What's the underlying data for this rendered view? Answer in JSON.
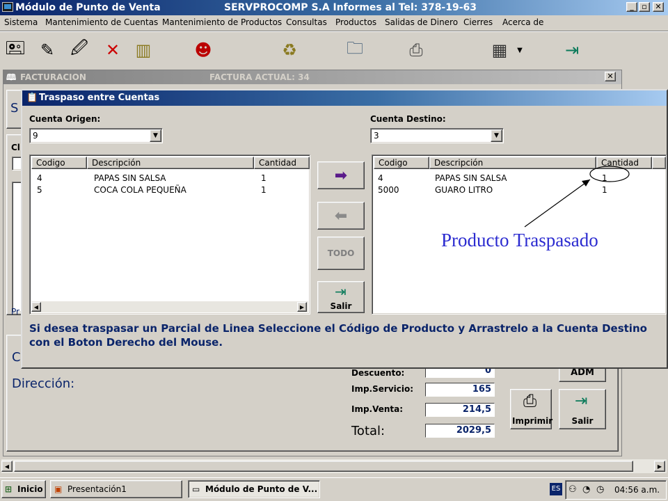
{
  "main_window": {
    "title": "Módulo de Punto de Venta",
    "company": "SERVPROCOMP S.A  Informes al Tel:  378-19-63",
    "controls": [
      "_",
      "▫",
      "✕"
    ]
  },
  "menu": [
    "Sistema",
    "Mantenimiento de Cuentas",
    "Mantenimiento de Productos",
    "Consultas",
    "Productos",
    "Salidas de Dinero",
    "Cierres",
    "Acerca de"
  ],
  "toolbar_icons": [
    "cash-register-icon",
    "edit-document-icon",
    "write-icon",
    "delete-icon",
    "basket-icon",
    "user-icon",
    "recycle-bin-icon",
    "folder-icon",
    "printer-icon",
    "calculator-icon",
    "exit-door-icon"
  ],
  "factura_window": {
    "title": "FACTURACION",
    "current": "FACTURA ACTUAL:  34",
    "left_fragments": [
      "S",
      "Cl",
      "C",
      "Pr"
    ],
    "direccion_label": "Dirección:",
    "c_label": "C",
    "descuento_label": "Descuento:",
    "descuento_value": "0",
    "imp_servicio_label": "Imp.Servicio:",
    "imp_servicio_value": "165",
    "imp_venta_label": "Imp.Venta:",
    "imp_venta_value": "214,5",
    "total_label": "Total:",
    "total_value": "2029,5",
    "adm_label": "ADM",
    "imprimir_label": "Imprimir",
    "salir_label": "Salir"
  },
  "dialog": {
    "title": "Traspaso entre Cuentas",
    "origen_label": "Cuenta Origen:",
    "origen_value": "9",
    "destino_label": "Cuenta Destino:",
    "destino_value": "3",
    "columns": [
      "Codigo",
      "Descripción",
      "Cantidad"
    ],
    "origen_rows": [
      {
        "codigo": "4",
        "descripcion": "PAPAS SIN SALSA",
        "cantidad": "1"
      },
      {
        "codigo": "5",
        "descripcion": "COCA COLA PEQUEÑA",
        "cantidad": "1"
      }
    ],
    "destino_rows": [
      {
        "codigo": "4",
        "descripcion": "PAPAS SIN SALSA",
        "cantidad": "1"
      },
      {
        "codigo": "5000",
        "descripcion": "GUARO LITRO",
        "cantidad": "1"
      }
    ],
    "todo_label": "TODO",
    "salir_label": "Salir",
    "hint": "Si desea traspasar un Parcial de Linea Seleccione el Código de Producto y Arrastrelo a la Cuenta Destino con el Boton Derecho del Mouse."
  },
  "annotation": {
    "text": "Producto Traspasado",
    "color": "#2b2bd0"
  },
  "taskbar": {
    "start": "Inicio",
    "tasks": [
      "Presentación1",
      "Módulo de Punto de V..."
    ],
    "lang": "ES",
    "clock": "04:56 a.m."
  }
}
